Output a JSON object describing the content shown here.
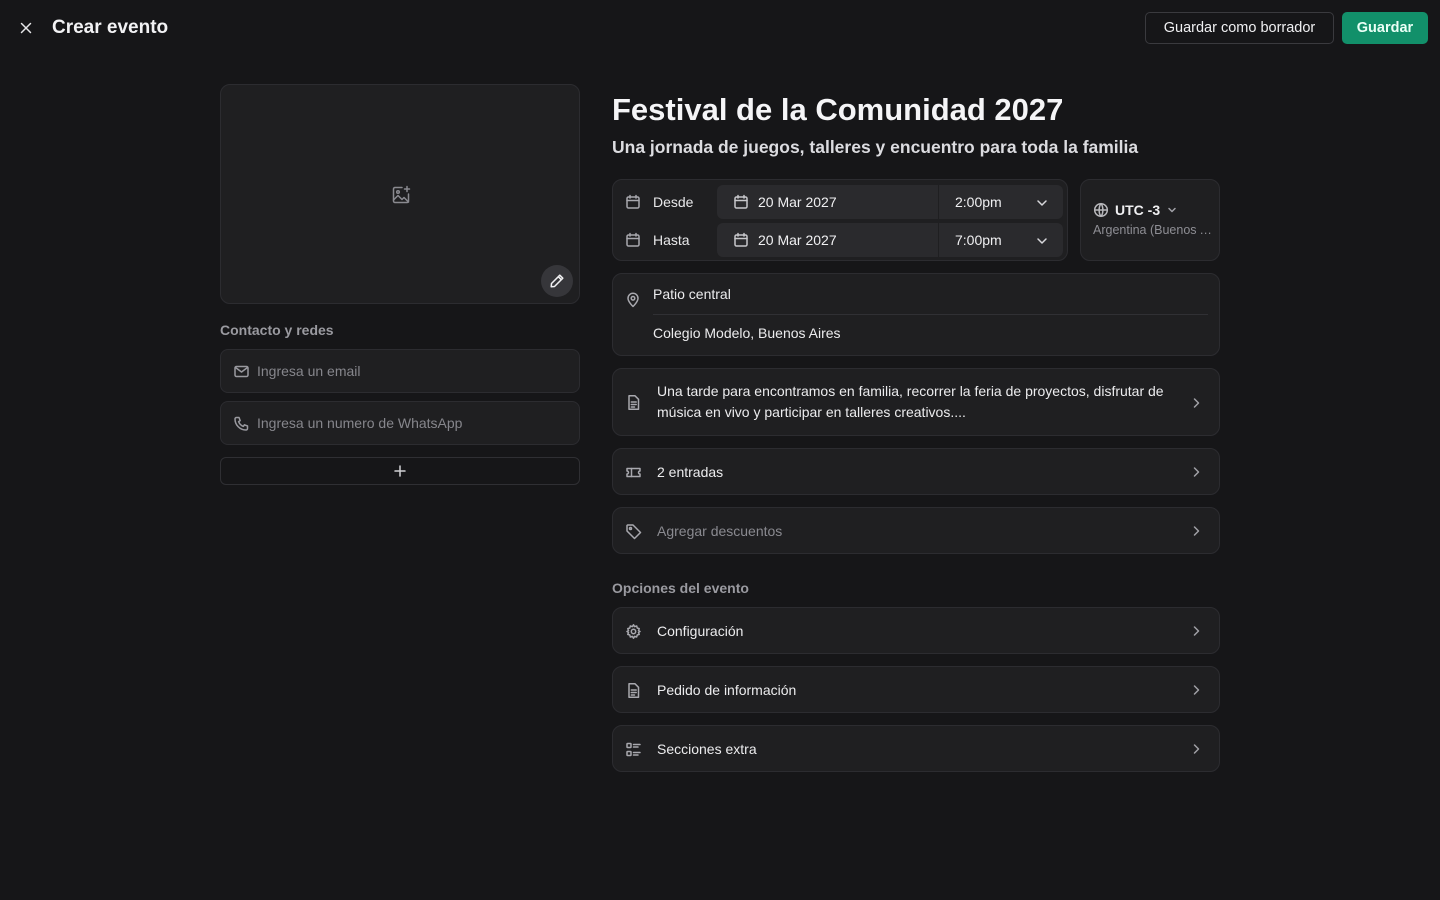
{
  "header": {
    "title": "Crear evento",
    "draft_label": "Guardar como borrador",
    "save_label": "Guardar"
  },
  "contact": {
    "title": "Contacto y redes",
    "email_placeholder": "Ingresa un email",
    "whatsapp_placeholder": "Ingresa un numero de WhatsApp"
  },
  "event": {
    "title": "Festival de la Comunidad 2027",
    "subtitle": "Una jornada de juegos, talleres y encuentro para toda la familia",
    "start": {
      "label": "Desde",
      "date": "20 Mar 2027",
      "time": "2:00pm"
    },
    "end": {
      "label": "Hasta",
      "date": "20 Mar 2027",
      "time": "7:00pm"
    },
    "timezone": {
      "offset": "UTC -3",
      "name": "Argentina (Buenos Aires)"
    },
    "location": {
      "place": "Patio central",
      "address": "Colegio Modelo, Buenos Aires"
    },
    "description": "Una tarde para encontramos en familia, recorrer la feria de proyectos, disfrutar de música en vivo y participar en talleres creativos....",
    "tickets_label": "2 entradas",
    "discounts_label": "Agregar descuentos"
  },
  "options": {
    "title": "Opciones del evento",
    "items": [
      {
        "label": "Configuración",
        "icon": "gear-icon"
      },
      {
        "label": "Pedido de información",
        "icon": "document-icon"
      },
      {
        "label": "Secciones extra",
        "icon": "list-icon"
      }
    ]
  },
  "colors": {
    "background": "#161618",
    "card": "#1f1f21",
    "accent": "#12906a"
  }
}
